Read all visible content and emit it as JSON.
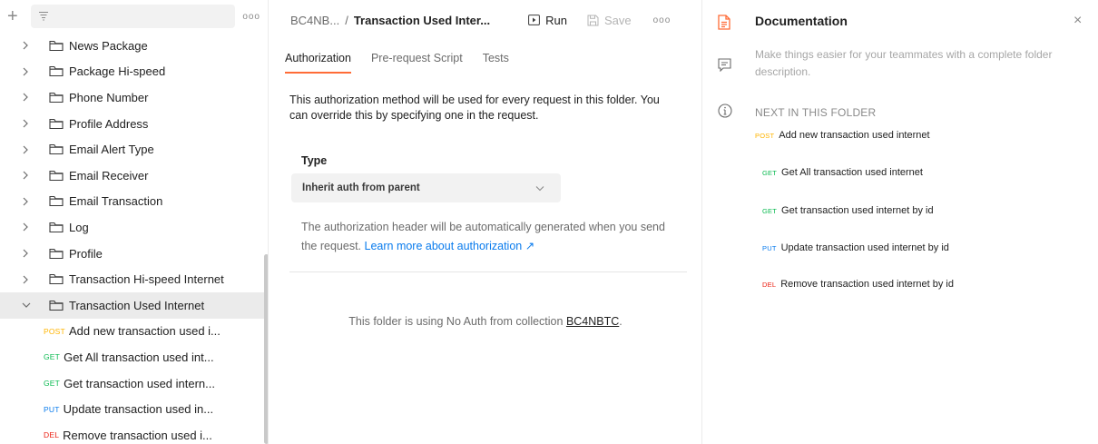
{
  "colors": {
    "accent": "#ff6c37",
    "post": "#ffb400",
    "get": "#0cbb52",
    "put": "#097bed",
    "del": "#eb2013"
  },
  "sidebar": {
    "plus": "+",
    "more": "ooo",
    "folders": [
      {
        "label": "News Package"
      },
      {
        "label": "Package Hi-speed"
      },
      {
        "label": "Phone Number"
      },
      {
        "label": "Profile Address"
      },
      {
        "label": "Email Alert Type"
      },
      {
        "label": "Email Receiver"
      },
      {
        "label": "Email Transaction"
      },
      {
        "label": "Log"
      },
      {
        "label": "Profile"
      },
      {
        "label": "Transaction Hi-speed Internet"
      },
      {
        "label": "Transaction Used Internet"
      }
    ],
    "requests": [
      {
        "method": "POST",
        "label": "Add new transaction used i..."
      },
      {
        "method": "GET",
        "label": "Get All transaction used int..."
      },
      {
        "method": "GET",
        "label": "Get transaction used intern..."
      },
      {
        "method": "PUT",
        "label": "Update transaction used in..."
      },
      {
        "method": "DEL",
        "label": "Remove transaction used i..."
      }
    ]
  },
  "header": {
    "collection": "BC4NB...",
    "separator": "/",
    "current": "Transaction Used Inter...",
    "run_label": "Run",
    "save_label": "Save",
    "more": "ooo"
  },
  "tabs": [
    {
      "label": "Authorization"
    },
    {
      "label": "Pre-request Script"
    },
    {
      "label": "Tests"
    }
  ],
  "auth": {
    "description": "This authorization method will be used for every request in this folder. You can override this by specifying one in the request.",
    "type_label": "Type",
    "type_value": "Inherit auth from parent",
    "note": "The authorization header will be automatically generated when you send the request.",
    "learn_more": "Learn more about authorization ↗",
    "noauth_prefix": "This folder is using No Auth from collection",
    "noauth_collection": "BC4NBTC",
    "noauth_suffix": "."
  },
  "docs": {
    "title": "Documentation",
    "close": "×",
    "description_placeholder": "Make things easier for your teammates with a complete folder description.",
    "next_header": "NEXT IN THIS FOLDER",
    "next_items": [
      {
        "method": "POST",
        "label": "Add new transaction used internet"
      },
      {
        "method": "GET",
        "label": "Get All transaction used internet"
      },
      {
        "method": "GET",
        "label": "Get transaction used internet by id"
      },
      {
        "method": "PUT",
        "label": "Update transaction used internet by id"
      },
      {
        "method": "DEL",
        "label": "Remove transaction used internet by id"
      }
    ]
  }
}
